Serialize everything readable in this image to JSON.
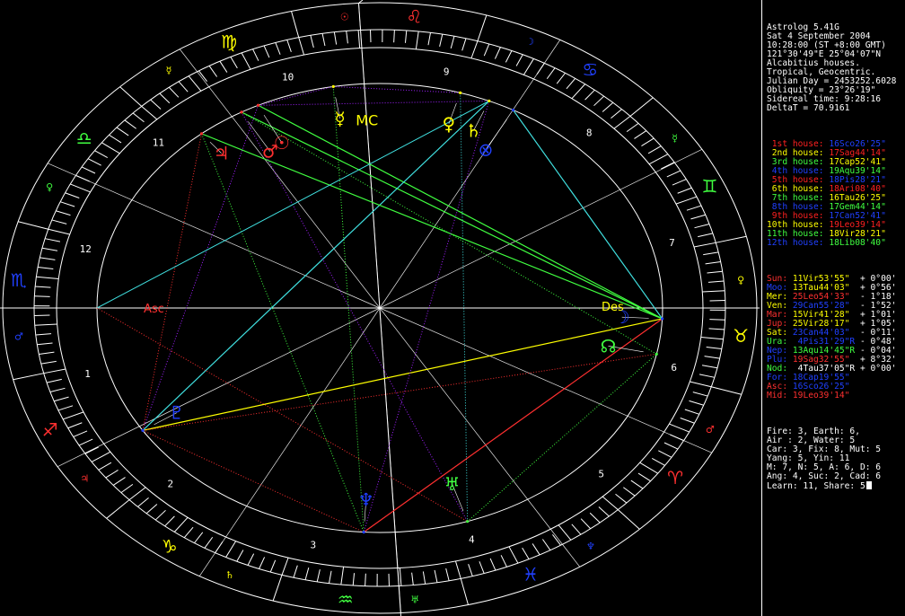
{
  "header": {
    "lines": [
      "Astrolog 5.41G",
      "Sat 4 September 2004",
      "10:28:00 (ST +8:00 GMT)",
      "121°30'49\"E 25°04'07\"N",
      "Alcabitius houses.",
      "Tropical, Geocentric.",
      "Julian Day = 2453252.6028",
      "Obliquity = 23°26'19\"",
      "Sidereal time: 9:28:16",
      "DeltaT = 70.9161"
    ]
  },
  "houses": [
    {
      "label": "1st house:",
      "value": "16Sco26'25\"",
      "label_color": "#ff2020",
      "value_color": "#2040ff"
    },
    {
      "label": "2nd house:",
      "value": "17Sag44'14\"",
      "label_color": "#ffff00",
      "value_color": "#ff2020"
    },
    {
      "label": "3rd house:",
      "value": "17Cap52'41\"",
      "label_color": "#40ff40",
      "value_color": "#ffff00"
    },
    {
      "label": "4th house:",
      "value": "19Aqu39'14\"",
      "label_color": "#2040ff",
      "value_color": "#40ff40"
    },
    {
      "label": "5th house:",
      "value": "18Pis28'21\"",
      "label_color": "#ff2020",
      "value_color": "#2040ff"
    },
    {
      "label": "6th house:",
      "value": "18Ari08'40\"",
      "label_color": "#ffff00",
      "value_color": "#ff2020"
    },
    {
      "label": "7th house:",
      "value": "16Tau26'25\"",
      "label_color": "#40ff40",
      "value_color": "#ffff00"
    },
    {
      "label": "8th house:",
      "value": "17Gem44'14\"",
      "label_color": "#2040ff",
      "value_color": "#40ff40"
    },
    {
      "label": "9th house:",
      "value": "17Can52'41\"",
      "label_color": "#ff2020",
      "value_color": "#2040ff"
    },
    {
      "label": "10th house:",
      "value": "19Leo39'14\"",
      "label_color": "#ffff00",
      "value_color": "#ff2020"
    },
    {
      "label": "11th house:",
      "value": "18Vir28'21\"",
      "label_color": "#40ff40",
      "value_color": "#ffff00"
    },
    {
      "label": "12th house:",
      "value": "18Lib08'40\"",
      "label_color": "#2040ff",
      "value_color": "#40ff40"
    }
  ],
  "planets": [
    {
      "name": "Sun:",
      "pos": "11Vir53'55\"",
      "lat": "+ 0°00'",
      "color": "#ff3030",
      "pos_color": "#ffff00"
    },
    {
      "name": "Moo:",
      "pos": "13Tau44'03\"",
      "lat": "+ 0°56'",
      "color": "#2040ff",
      "pos_color": "#ffff00"
    },
    {
      "name": "Mer:",
      "pos": "25Leo54'33\"",
      "lat": "- 1°18'",
      "color": "#ffff00",
      "pos_color": "#ff3030"
    },
    {
      "name": "Ven:",
      "pos": "29Can55'28\"",
      "lat": "- 1°52'",
      "color": "#ffff00",
      "pos_color": "#2040ff"
    },
    {
      "name": "Mar:",
      "pos": "15Vir41'28\"",
      "lat": "+ 1°01'",
      "color": "#ff3030",
      "pos_color": "#ffff00"
    },
    {
      "name": "Jup:",
      "pos": "25Vir28'17\"",
      "lat": "+ 1°05'",
      "color": "#ff3030",
      "pos_color": "#ffff00"
    },
    {
      "name": "Sat:",
      "pos": "23Can44'03\"",
      "lat": "- 0°11'",
      "color": "#ffff00",
      "pos_color": "#2040ff"
    },
    {
      "name": "Ura:",
      "pos": " 4Pis31'29\"R",
      "lat": "- 0°48'",
      "color": "#40ff40",
      "pos_color": "#2040ff"
    },
    {
      "name": "Nep:",
      "pos": "13Aqu14'45\"R",
      "lat": "- 0°04'",
      "color": "#2040ff",
      "pos_color": "#40ff40"
    },
    {
      "name": "Plu:",
      "pos": "19Sag32'55\"",
      "lat": "+ 8°32'",
      "color": "#2040ff",
      "pos_color": "#ff3030"
    },
    {
      "name": "Nod:",
      "pos": " 4Tau37'05\"R",
      "lat": "+ 0°00'",
      "color": "#40ff40",
      "pos_color": "#ffffff"
    },
    {
      "name": "For:",
      "pos": "18Cap19'55\"",
      "lat": "",
      "color": "#2040ff",
      "pos_color": "#2040ff"
    },
    {
      "name": "Asc:",
      "pos": "16Sco26'25\"",
      "lat": "",
      "color": "#ff3030",
      "pos_color": "#2040ff"
    },
    {
      "name": "Mid:",
      "pos": "19Leo39'14\"",
      "lat": "",
      "color": "#ff3030",
      "pos_color": "#ff3030"
    }
  ],
  "stats": [
    "Fire: 3, Earth: 6,",
    "Air : 2, Water: 5",
    "Car: 3, Fix: 8, Mut: 5",
    "Yang: 5, Yin: 11",
    "M: 7, N: 5, A: 6, D: 6",
    "Ang: 4, Suc: 2, Cad: 6",
    "Learn: 11, Share: 5"
  ],
  "wheel": {
    "colors": {
      "fire": "#ff3030",
      "earth": "#ffff00",
      "air": "#40ff40",
      "water": "#2040ff",
      "ring": "#ffffff"
    },
    "asc_label": "Asc",
    "des_label": "Des",
    "mc_label": "MC",
    "house_numbers": [
      "1",
      "2",
      "3",
      "4",
      "5",
      "6",
      "7",
      "8",
      "9",
      "10",
      "11",
      "12"
    ],
    "signs": [
      {
        "name": "aries-icon",
        "glyph": "♈",
        "color": "#ff3030",
        "ruler": "♂",
        "ruler_name": "mars-icon"
      },
      {
        "name": "taurus-icon",
        "glyph": "♉",
        "color": "#ffff00",
        "ruler": "♀",
        "ruler_name": "venus-icon"
      },
      {
        "name": "gemini-icon",
        "glyph": "♊",
        "color": "#40ff40",
        "ruler": "☿",
        "ruler_name": "mercury-icon"
      },
      {
        "name": "cancer-icon",
        "glyph": "♋",
        "color": "#2040ff",
        "ruler": "☽",
        "ruler_name": "moon-icon"
      },
      {
        "name": "leo-icon",
        "glyph": "♌",
        "color": "#ff3030",
        "ruler": "☉",
        "ruler_name": "sun-icon"
      },
      {
        "name": "virgo-icon",
        "glyph": "♍",
        "color": "#ffff00",
        "ruler": "☿",
        "ruler_name": "mercury-icon"
      },
      {
        "name": "libra-icon",
        "glyph": "♎",
        "color": "#40ff40",
        "ruler": "♀",
        "ruler_name": "venus-icon"
      },
      {
        "name": "scorpio-icon",
        "glyph": "♏",
        "color": "#2040ff",
        "ruler": "♂",
        "ruler_name": "mars-icon"
      },
      {
        "name": "sagittarius-icon",
        "glyph": "♐",
        "color": "#ff3030",
        "ruler": "♃",
        "ruler_name": "jupiter-icon"
      },
      {
        "name": "capricorn-icon",
        "glyph": "♑",
        "color": "#ffff00",
        "ruler": "♄",
        "ruler_name": "saturn-icon"
      },
      {
        "name": "aquarius-icon",
        "glyph": "♒",
        "color": "#40ff40",
        "ruler": "♅",
        "ruler_name": "uranus-icon"
      },
      {
        "name": "pisces-icon",
        "glyph": "♓",
        "color": "#2040ff",
        "ruler": "♆",
        "ruler_name": "neptune-icon"
      }
    ],
    "planet_glyphs": [
      {
        "key": "mars",
        "name": "mars-icon",
        "glyph": "♂",
        "color": "#ff3030",
        "lon": 165.7
      },
      {
        "key": "sun",
        "name": "sun-icon",
        "glyph": "☉",
        "color": "#ff3030",
        "lon": 161.9
      },
      {
        "key": "jupiter",
        "name": "jupiter-icon",
        "glyph": "♃",
        "color": "#ff3030",
        "lon": 175.5
      },
      {
        "key": "mercury",
        "name": "mercury-icon",
        "glyph": "☿",
        "color": "#ffff00",
        "lon": 145.9
      },
      {
        "key": "venus",
        "name": "venus-icon",
        "glyph": "♀",
        "color": "#ffff00",
        "lon": 119.9
      },
      {
        "key": "saturn",
        "name": "saturn-icon",
        "glyph": "♄",
        "color": "#ffff00",
        "lon": 113.7
      },
      {
        "key": "fortune",
        "name": "fortune-icon",
        "glyph": "⊗",
        "color": "#2040ff",
        "lon": 108.3
      },
      {
        "key": "moon",
        "name": "moon-icon",
        "glyph": "☽",
        "color": "#2040ff",
        "lon": 43.7
      },
      {
        "key": "node",
        "name": "node-icon",
        "glyph": "☊",
        "color": "#40ff40",
        "lon": 34.6
      },
      {
        "key": "uranus",
        "name": "uranus-icon",
        "glyph": "♅",
        "color": "#40ff40",
        "lon": 334.5
      },
      {
        "key": "neptune",
        "name": "neptune-icon",
        "glyph": "♆",
        "color": "#2040ff",
        "lon": 313.2
      },
      {
        "key": "pluto",
        "name": "pluto-icon",
        "glyph": "♇",
        "color": "#2040ff",
        "lon": 259.5
      }
    ]
  }
}
